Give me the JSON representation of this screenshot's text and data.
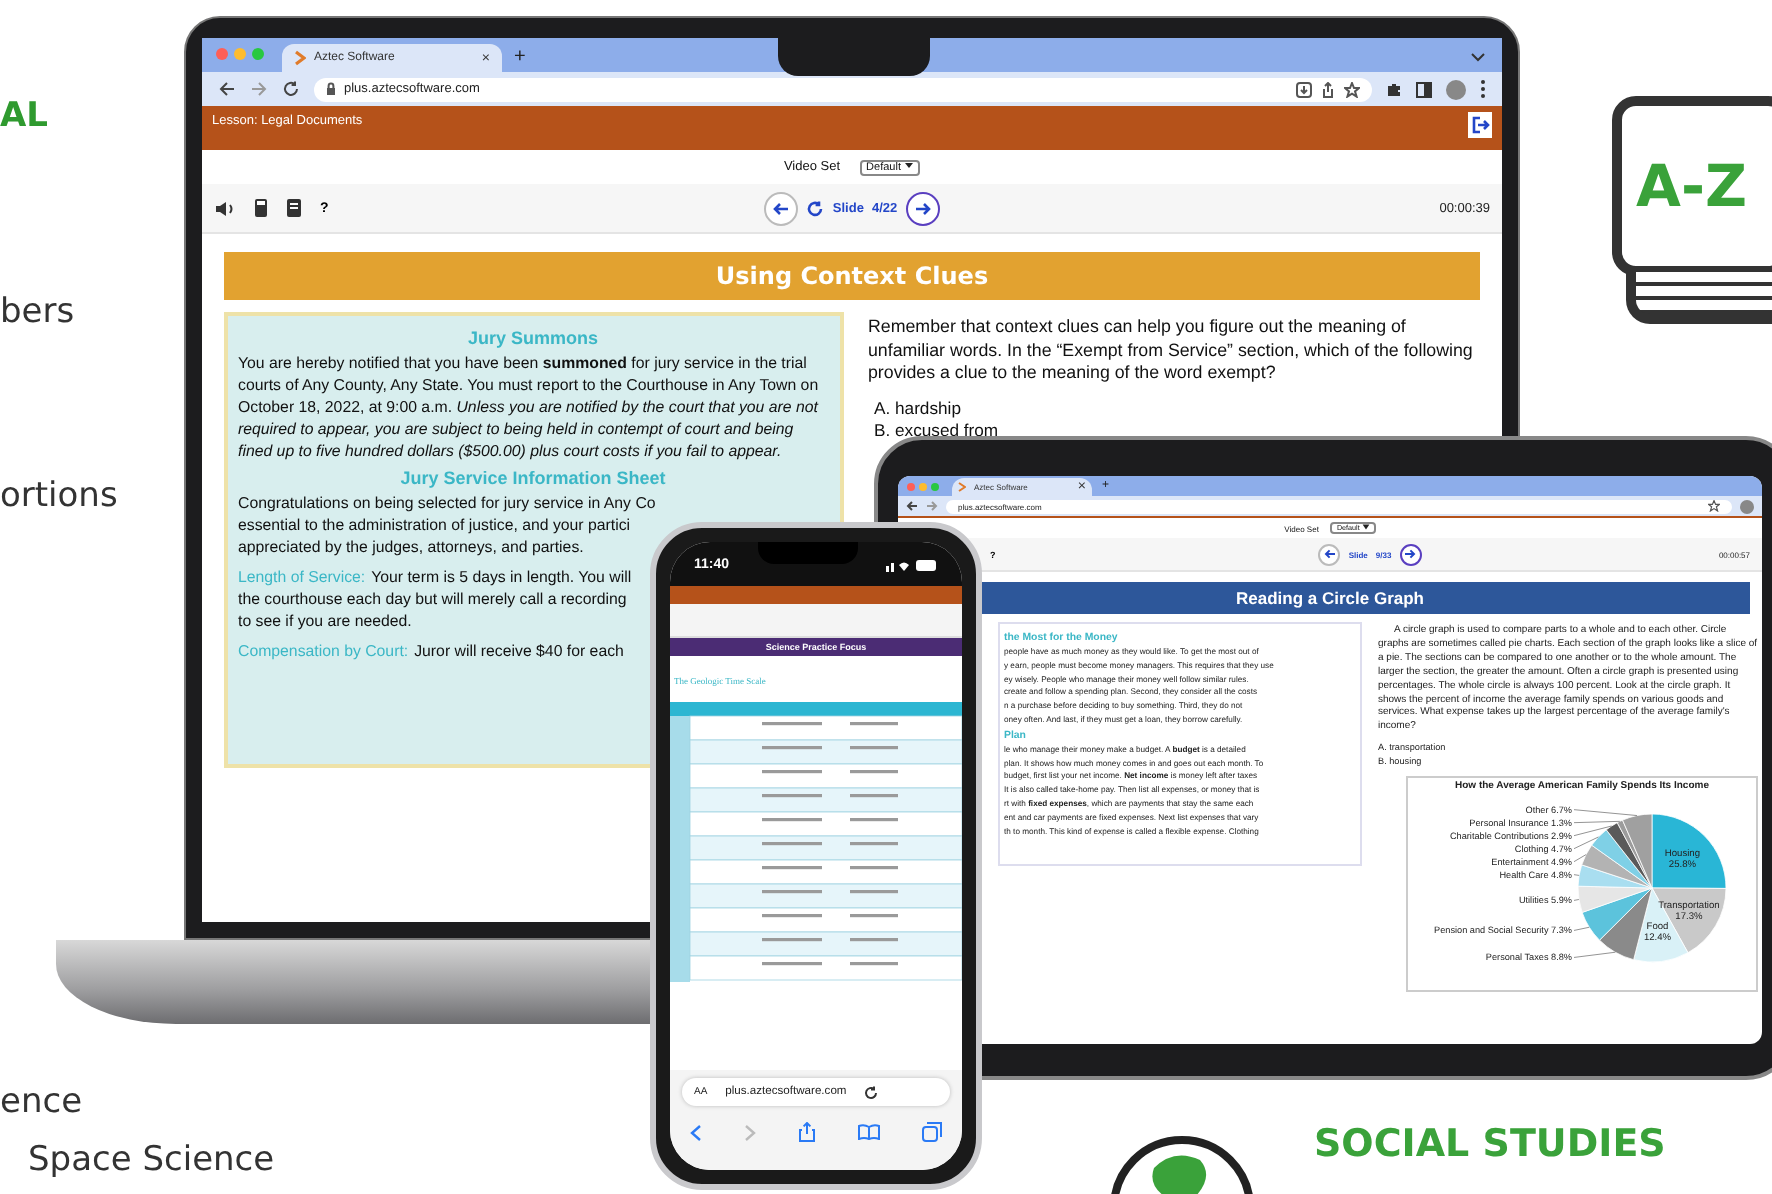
{
  "side_texts": [
    {
      "text": "AL",
      "kind": "accent"
    },
    {
      "text": "bers",
      "kind": "plain"
    },
    {
      "text": "ortions",
      "kind": "plain"
    },
    {
      "text": "ence",
      "kind": "plain"
    },
    {
      "text": "Space Science",
      "kind": "plain"
    }
  ],
  "laptop": {
    "browser": {
      "tab": "Aztec Software",
      "close": "×",
      "new_tab": "+",
      "url": "plus.aztecsoftware.com"
    },
    "lesson": "Lesson: Legal Documents",
    "video_set": {
      "label": "Video Set",
      "value": "Default"
    },
    "help": "?",
    "slide_label": "Slide",
    "slide_count": "4/22",
    "timer": "00:00:39",
    "title": "Using Context Clues",
    "passage": {
      "heading": "Jury Summons",
      "paragraph": "You are hereby notified that you have been **summoned** for jury service in the trial courts of Any County, Any State. You must report to the Courthouse in Any Town on October 18, 2022, at 9:00 a.m. *Unless you are notified by the court that you are not required to appear, you are subject to being held in contempt of court and being fined up to five hundred dollars ($500.00) plus court costs if you fail to appear.*",
      "heading_2": "Jury Service Information Sheet",
      "lines": [
        {
          "text": "Congratulations on being selected for jury service in Any Co"
        },
        {
          "text": "essential to the administration of justice, and your partici"
        },
        {
          "text": "appreciated by the judges, attorneys, and parties."
        },
        {
          "label": "Length of Service:",
          "text": "Your term is 5 days in length. You will"
        },
        {
          "text": "the courthouse each day but will merely call a recording"
        },
        {
          "text": "to see if you are needed."
        },
        {
          "label": "Compensation by Court:",
          "text": "Juror will receive $40 for each"
        }
      ]
    },
    "question": "Remember that context clues can help you figure out the meaning of unfamiliar words. In the “Exempt from Service” section, which of the following provides a clue to the meaning of the word exempt?",
    "options": [
      "A. hardship",
      "B. excused from"
    ]
  },
  "tablet": {
    "browser": {
      "tab": "Aztec Software",
      "close": "×",
      "new_tab": "+",
      "url": "plus.aztecsoftware.com"
    },
    "video_set": {
      "label": "Video Set",
      "value": "Default"
    },
    "help": "?",
    "slide_label": "Slide",
    "slide_count": "9/33",
    "timer": "00:00:57",
    "title": "Reading a Circle Graph",
    "passage": {
      "heading": "the Most for the Money",
      "lines_1": [
        "people have as much money as they would like. To get the most out of",
        "y earn, people must become money managers. This requires that they use",
        "ey wisely. People who manage their money well follow similar rules.",
        "create and follow a spending plan. Second, they consider all the costs",
        "n a purchase before deciding to buy something. Third, they do not",
        "oney often. And last, if they must get a loan, they borrow carefully."
      ],
      "heading_2": "Plan",
      "lines_2": [
        "le who manage their money make a budget. A **budget** is a detailed",
        "plan. It shows how much money comes in and goes out each month. To",
        "budget, first list your net income. **Net income** is money left after taxes",
        "It is also called take-home pay. Then list all expenses, or money that is",
        "rt with **fixed expenses**, which are payments that stay the same each",
        "ent and car payments are fixed expenses. Next list expenses that vary",
        "th to month. This kind of expense is called a flexible expense. Clothing"
      ]
    },
    "question": "A circle graph is used to compare parts to a whole and to each other. Circle graphs are sometimes called pie charts. Each section of the graph looks like a slice of a pie. The sections can be compared to one another or to the whole amount. The larger the section, the greater the amount. Often a circle graph is presented using percentages. The whole circle is always 100 percent. Look at the circle graph. It shows the percent of income the average family spends on various goods and services. What expense takes up the largest percentage of the average family's income?",
    "options": [
      "A. transportation",
      "B. housing"
    ],
    "chart_data": {
      "type": "pie",
      "title": "How the Average American Family Spends Its Income",
      "categories": [
        "Housing",
        "Transportation",
        "Food",
        "Personal Taxes",
        "Pension and Social Security",
        "Utilities",
        "Health Care",
        "Entertainment",
        "Clothing",
        "Charitable Contributions",
        "Personal Insurance",
        "Other"
      ],
      "values": [
        25.8,
        17.3,
        12.4,
        8.8,
        7.3,
        5.9,
        4.8,
        4.9,
        4.7,
        2.9,
        1.3,
        6.7
      ],
      "value_labels": [
        "25.8%",
        "17.3%",
        "12.4%",
        "8.8%",
        "7.3%",
        "5.9%",
        "4.8%",
        "4.9%",
        "4.7%",
        "2.9%",
        "1.3%",
        "6.7%"
      ]
    }
  },
  "phone": {
    "time": "11:40",
    "title": "Science Practice Focus",
    "subtitle": "The Geologic Time Scale",
    "text_size": "AA",
    "url": "plus.aztecsoftware.com"
  },
  "az_badge": {
    "text": "A-Z"
  },
  "subject": {
    "text": "SOCIAL STUDIES"
  }
}
